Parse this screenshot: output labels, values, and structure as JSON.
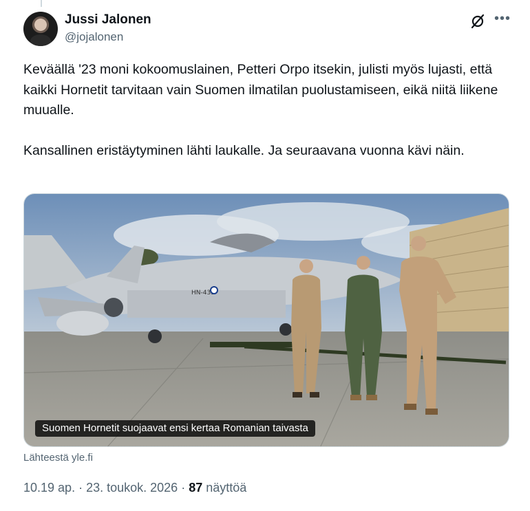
{
  "author": {
    "name": "Jussi Jalonen",
    "handle": "@jojalonen"
  },
  "icons": {
    "grok": "grok-icon",
    "more": "more-options-icon"
  },
  "tweet": {
    "text": "Keväällä '23 moni kokoomuslainen, Petteri Orpo itsekin, julisti myös lujasti, että kaikki Hornetit tarvitaan vain Suomen ilmatilan puolustamiseen, eikä niitä liikene muualle.\n\nKansallinen eristäytyminen lähti laukalle. Ja seuraavana vuonna kävi näin."
  },
  "card": {
    "image_caption": "Suomen Hornetit suojaavat ensi kertaa Romanian taivasta",
    "aircraft_marking": "HN-433",
    "source": "Lähteestä yle.fi"
  },
  "meta": {
    "time": "10.19 ap.",
    "separator": " · ",
    "date": "23. toukok. 2026",
    "views_count": "87",
    "views_label": "näyttöä"
  },
  "colors": {
    "text": "#0f1419",
    "secondary": "#536471",
    "border": "#cfd9de"
  }
}
